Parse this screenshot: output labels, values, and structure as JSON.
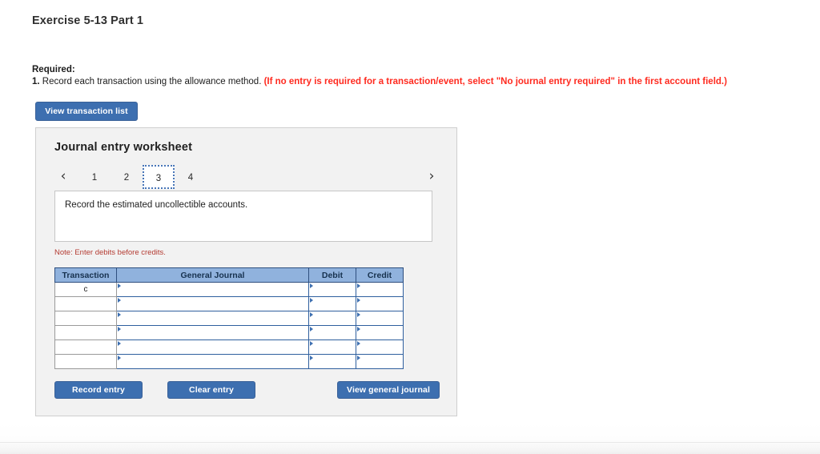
{
  "exercise": {
    "title": "Exercise 5-13 Part 1"
  },
  "required": {
    "label": "Required:",
    "number": "1.",
    "instruction": " Record each transaction using the allowance method. ",
    "red_note": "(If no entry is required for a transaction/event, select \"No journal entry required\" in the first account field.)"
  },
  "toolbar": {
    "view_transaction_list_label": "View transaction list"
  },
  "worksheet": {
    "title": "Journal entry worksheet",
    "pager": {
      "prev_icon": "chevron-left-icon",
      "next_icon": "chevron-right-icon",
      "prev_glyph": "‹",
      "next_glyph": "›",
      "tabs": [
        {
          "label": "1",
          "active": false
        },
        {
          "label": "2",
          "active": false
        },
        {
          "label": "3",
          "active": true
        },
        {
          "label": "4",
          "active": false
        }
      ],
      "active_tab": "3"
    },
    "description": "Record the estimated uncollectible accounts.",
    "note": "Note: Enter debits before credits.",
    "table": {
      "columns": [
        "Transaction",
        "General Journal",
        "Debit",
        "Credit"
      ],
      "rows": [
        {
          "transaction": "c",
          "general_journal": "",
          "debit": "",
          "credit": ""
        },
        {
          "transaction": "",
          "general_journal": "",
          "debit": "",
          "credit": ""
        },
        {
          "transaction": "",
          "general_journal": "",
          "debit": "",
          "credit": ""
        },
        {
          "transaction": "",
          "general_journal": "",
          "debit": "",
          "credit": ""
        },
        {
          "transaction": "",
          "general_journal": "",
          "debit": "",
          "credit": ""
        },
        {
          "transaction": "",
          "general_journal": "",
          "debit": "",
          "credit": ""
        }
      ]
    },
    "actions": {
      "record_entry_label": "Record entry",
      "clear_entry_label": "Clear entry",
      "view_general_journal_label": "View general journal"
    }
  },
  "colors": {
    "button_blue": "#3d6fb0",
    "table_header_blue": "#90b2dd",
    "red_alert": "#ff2a1f",
    "note_red": "#b43b32",
    "panel_background": "#f2f2f2",
    "input_border_blue": "#2f5f9e"
  }
}
